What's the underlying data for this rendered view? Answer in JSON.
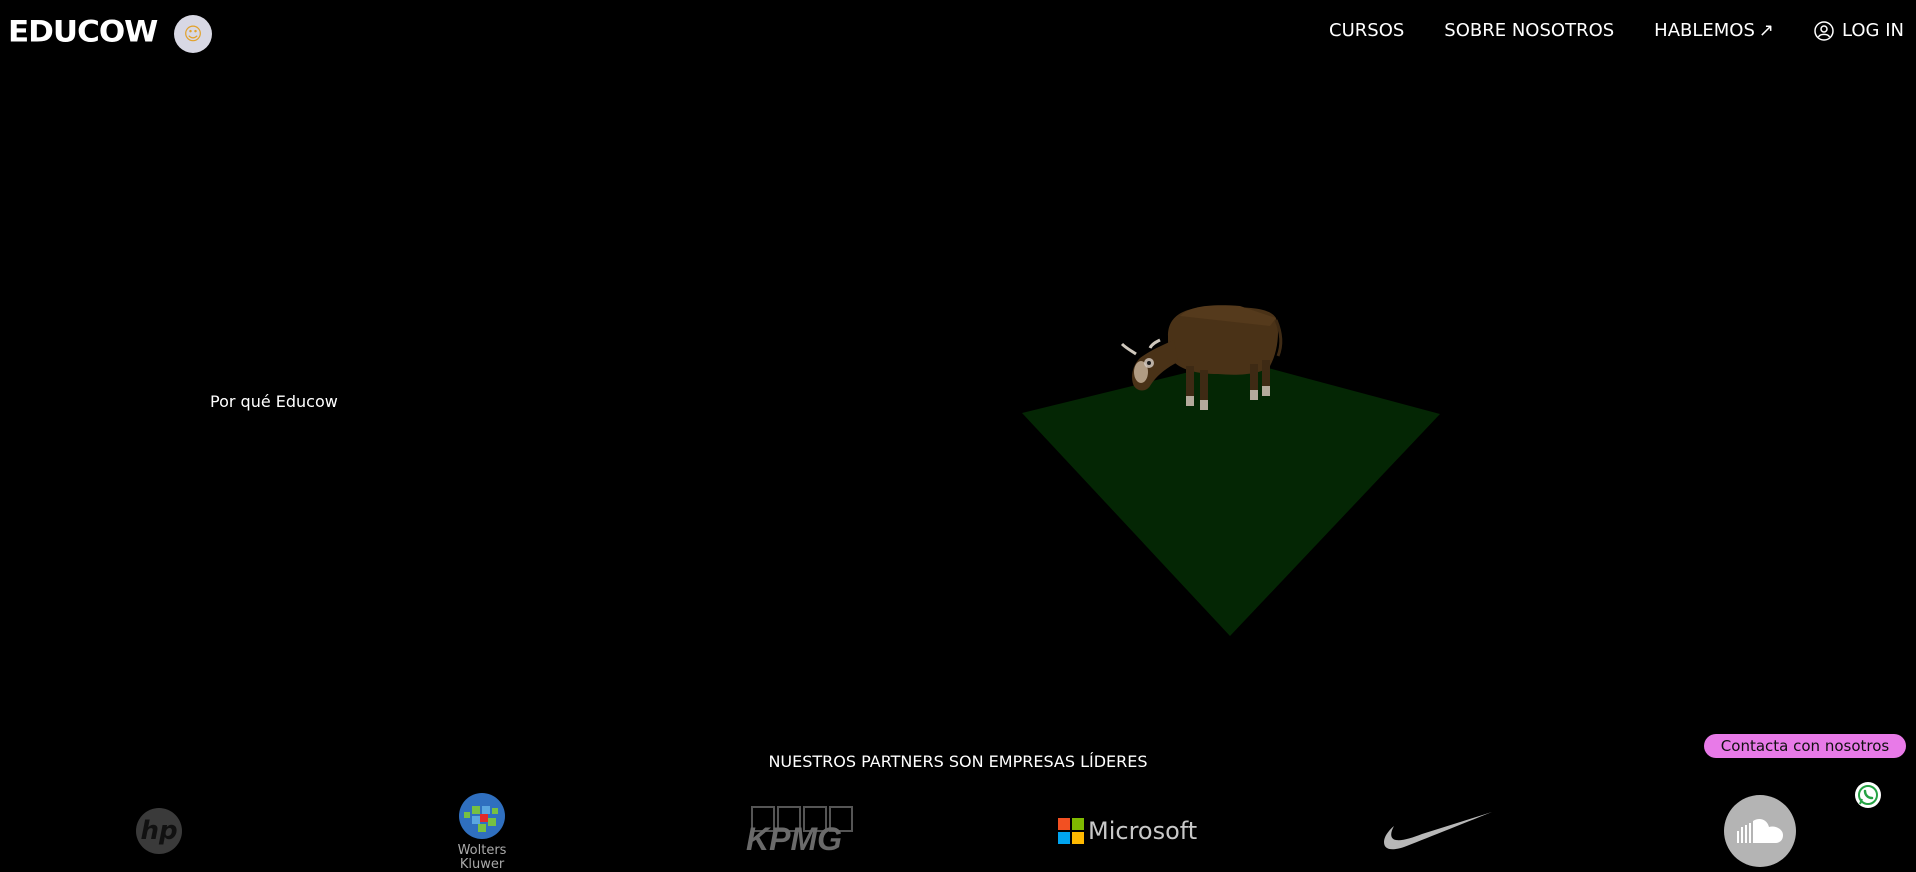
{
  "header": {
    "logo_text": "EDUCOW",
    "nav": [
      {
        "label": "CURSOS"
      },
      {
        "label": "SOBRE NOSOTROS"
      },
      {
        "label": "HABLEMOS",
        "arrow": "↗"
      },
      {
        "label": "LOG IN",
        "icon": "user-icon"
      }
    ]
  },
  "hero": {
    "why_link": "Por qué Educow",
    "scene_icons": [
      "cow-icon",
      "grass-plane"
    ]
  },
  "partners": {
    "title": "NUESTROS PARTNERS SON EMPRESAS LÍDERES",
    "logos": [
      {
        "name": "hp",
        "text": "hp"
      },
      {
        "name": "wolters-kluwer",
        "text_line1": "Wolters",
        "text_line2": "Kluwer"
      },
      {
        "name": "kpmg",
        "text": "KPMG"
      },
      {
        "name": "microsoft",
        "text": "Microsoft"
      },
      {
        "name": "nike"
      },
      {
        "name": "soundcloud"
      }
    ]
  },
  "contact": {
    "button_label": "Contacta con nosotros",
    "whatsapp_icon": "whatsapp-icon"
  },
  "colors": {
    "background": "#000000",
    "grass": "#042604",
    "cow": "#4a3217",
    "contact_button": "#e87ae8"
  }
}
